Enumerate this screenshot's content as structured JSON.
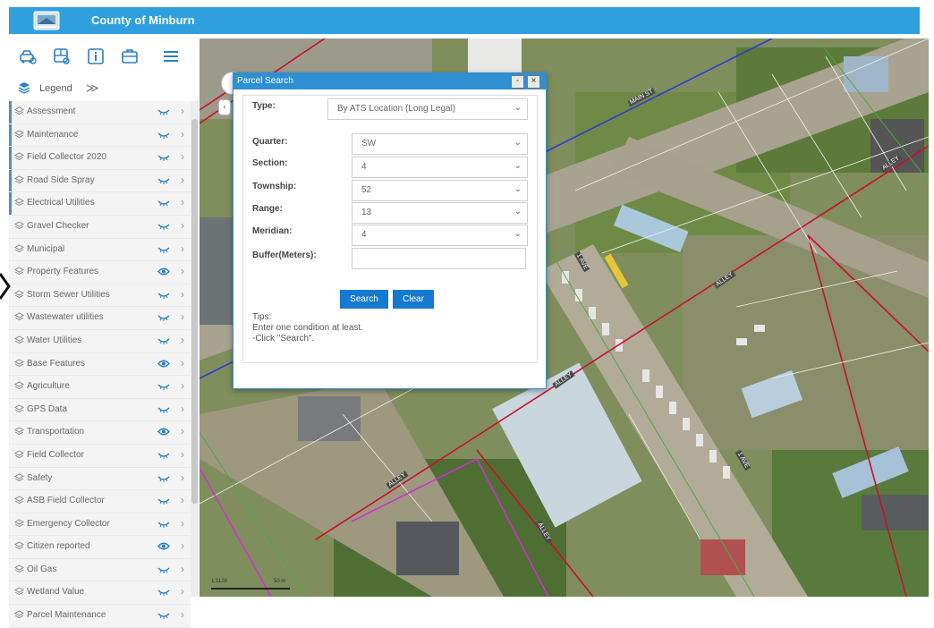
{
  "app": {
    "title": "County of Minburn"
  },
  "toolbar": {
    "icons": [
      "vehicle-search-icon",
      "bus-search-icon",
      "info-icon",
      "briefcase-icon",
      "menu-icon"
    ]
  },
  "legend": {
    "label": "Legend",
    "chevron": "≫"
  },
  "layers": [
    {
      "name": "Assessment",
      "visible": false,
      "marked": true
    },
    {
      "name": "Maintenance",
      "visible": false,
      "marked": true
    },
    {
      "name": "Field Collector 2020",
      "visible": false,
      "marked": true
    },
    {
      "name": "Road Side Spray",
      "visible": false,
      "marked": true
    },
    {
      "name": "Electrical Utilities",
      "visible": false,
      "marked": true
    },
    {
      "name": "Gravel Checker",
      "visible": false,
      "marked": false
    },
    {
      "name": "Municipal",
      "visible": false,
      "marked": false
    },
    {
      "name": "Property Features",
      "visible": true,
      "marked": false
    },
    {
      "name": "Storm Sewer Utilities",
      "visible": false,
      "marked": false
    },
    {
      "name": "Wastewater utilities",
      "visible": false,
      "marked": false
    },
    {
      "name": "Water Utilities",
      "visible": false,
      "marked": false
    },
    {
      "name": "Base Features",
      "visible": true,
      "marked": false
    },
    {
      "name": "Agriculture",
      "visible": false,
      "marked": false
    },
    {
      "name": "GPS Data",
      "visible": false,
      "marked": false
    },
    {
      "name": "Transportation",
      "visible": true,
      "marked": false
    },
    {
      "name": "Field Collector",
      "visible": false,
      "marked": false
    },
    {
      "name": "Safety",
      "visible": false,
      "marked": false
    },
    {
      "name": "ASB Field Collector",
      "visible": false,
      "marked": false
    },
    {
      "name": "Emergency Collector",
      "visible": false,
      "marked": false
    },
    {
      "name": "Citizen reported",
      "visible": true,
      "marked": false
    },
    {
      "name": "Oil Gas",
      "visible": false,
      "marked": false
    },
    {
      "name": "Wetland Value",
      "visible": false,
      "marked": false
    },
    {
      "name": "Parcel Maintenance",
      "visible": false,
      "marked": false
    }
  ],
  "dialog": {
    "title": "Parcel Search",
    "minimize": "-",
    "close": "×",
    "type_label": "Type:",
    "type_value": "By ATS Location (Long Legal)",
    "quarter_label": "Quarter:",
    "quarter_value": "SW",
    "section_label": "Section:",
    "section_value": "4",
    "township_label": "Township:",
    "township_value": "52",
    "range_label": "Range:",
    "range_value": "13",
    "meridian_label": "Meridian:",
    "meridian_value": "4",
    "buffer_label": "Buffer(Meters):",
    "buffer_value": "",
    "search_label": "Search",
    "clear_label": "Clear",
    "tips_title": "Tips:",
    "tips_line1": "Enter one condition at least.",
    "tips_line2": "-Click \"Search\"."
  },
  "map": {
    "road_labels": [
      "MAIN ST",
      "ALLEY",
      "ALLEY",
      "ALLEY",
      "ALLEY",
      "ALLEY",
      "1 AVE",
      "1 AVE"
    ],
    "scale_text": "1:1128",
    "scale_units": "50 m"
  },
  "colors": {
    "header": "#2fa0dd",
    "dialog_header": "#2e8fd3",
    "button": "#1479cf",
    "parcel_line": "#c8102e",
    "boundary_line": "#cc33cc",
    "road_line": "#2d3adb"
  }
}
